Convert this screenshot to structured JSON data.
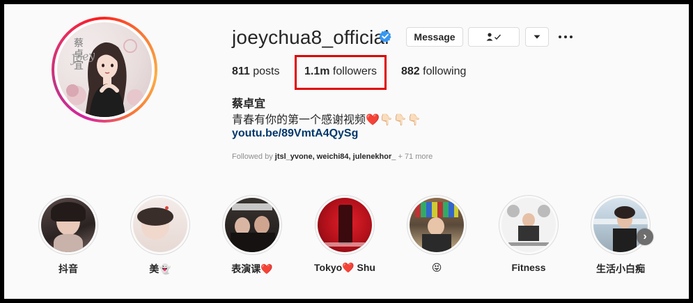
{
  "profile": {
    "username": "joeychua8_official",
    "full_name": "蔡卓宜",
    "bio": "青春有你的第一个感谢视频❤️👇🏻👇🏻👇🏻",
    "link": "youtu.be/89VmtA4QySg",
    "avatar_text_cn": "蔡卓宜",
    "avatar_text_en": "Joey",
    "verified_icon": "verified-badge-icon"
  },
  "actions": {
    "message_label": "Message",
    "follow_icon": "person-check-icon",
    "more_icon": "chevron-down-icon",
    "options_icon": "ellipsis-icon"
  },
  "stats": {
    "posts_count": "811",
    "posts_label": " posts",
    "followers_count": "1.1m",
    "followers_label": " followers",
    "following_count": "882",
    "following_label": " following"
  },
  "followed_by": {
    "prefix": "Followed by ",
    "names": "jtsl_yvone, weichi84, julenekhor_",
    "more": " + 71 more"
  },
  "highlights": [
    {
      "label": "抖音"
    },
    {
      "label": "美👻"
    },
    {
      "label": "表演课❤️"
    },
    {
      "label": "Tokyo❤️ Shu"
    },
    {
      "label": "😝"
    },
    {
      "label": "Fitness"
    },
    {
      "label": "生活小白痴"
    }
  ],
  "colors": {
    "highlight_box": "#e00000",
    "link": "#00376b",
    "verified": "#3897f0"
  }
}
